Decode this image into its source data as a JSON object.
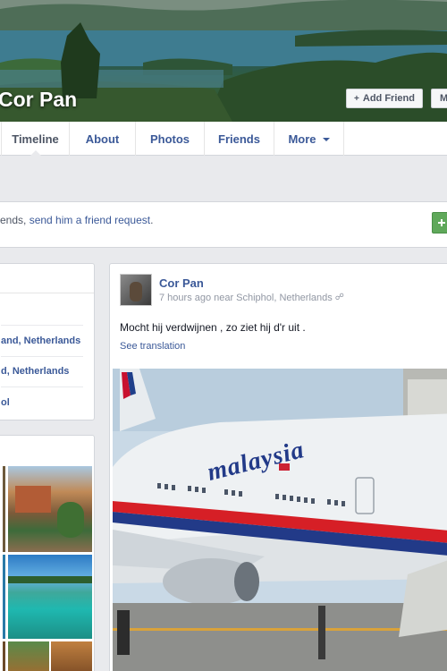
{
  "profile": {
    "name": "Cor Pan",
    "add_friend_label": "Add Friend",
    "message_label": "M"
  },
  "nav": {
    "tabs": [
      {
        "label": "Timeline",
        "active": true
      },
      {
        "label": "About"
      },
      {
        "label": "Photos"
      },
      {
        "label": "Friends"
      },
      {
        "label": "More"
      }
    ]
  },
  "request": {
    "prefix": "ends, ",
    "link": "send him a friend request",
    "suffix": "."
  },
  "about": {
    "items": [
      "and, Netherlands",
      "d, Netherlands",
      "ol"
    ]
  },
  "post": {
    "author": "Cor Pan",
    "time": "7 hours ago",
    "near": "near",
    "place": "Schiphol, Netherlands",
    "text": "Mocht hij verdwijnen , zo ziet hij d'r uit .",
    "see_translation": "See translation",
    "photo_livery_text": "malaysia"
  },
  "colors": {
    "link": "#3b5998",
    "background": "#e9eaed",
    "green_button": "#5fa85a"
  }
}
